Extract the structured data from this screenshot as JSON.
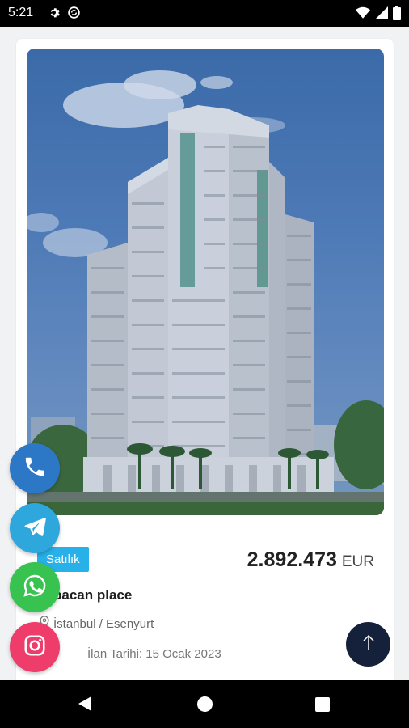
{
  "status_bar": {
    "time": "5:21",
    "left_icons": [
      "gear-icon",
      "sync-icon"
    ],
    "right_icons": [
      "wifi-icon",
      "signal-icon",
      "battery-icon"
    ]
  },
  "listing": {
    "badge": "Satılık",
    "price_amount": "2.892.473",
    "price_currency": "EUR",
    "title": "bacan place",
    "location": "İstanbul / Esenyurt",
    "date_label": "İlan Tarihi:",
    "date_value": "15 Ocak 2023",
    "image": "building-photo"
  },
  "contact_buttons": [
    "phone-icon",
    "telegram-icon",
    "whatsapp-icon",
    "instagram-icon"
  ],
  "scroll_top_icon": "arrow-up-icon",
  "nav_bar": [
    "back-icon",
    "home-icon",
    "recents-icon"
  ]
}
